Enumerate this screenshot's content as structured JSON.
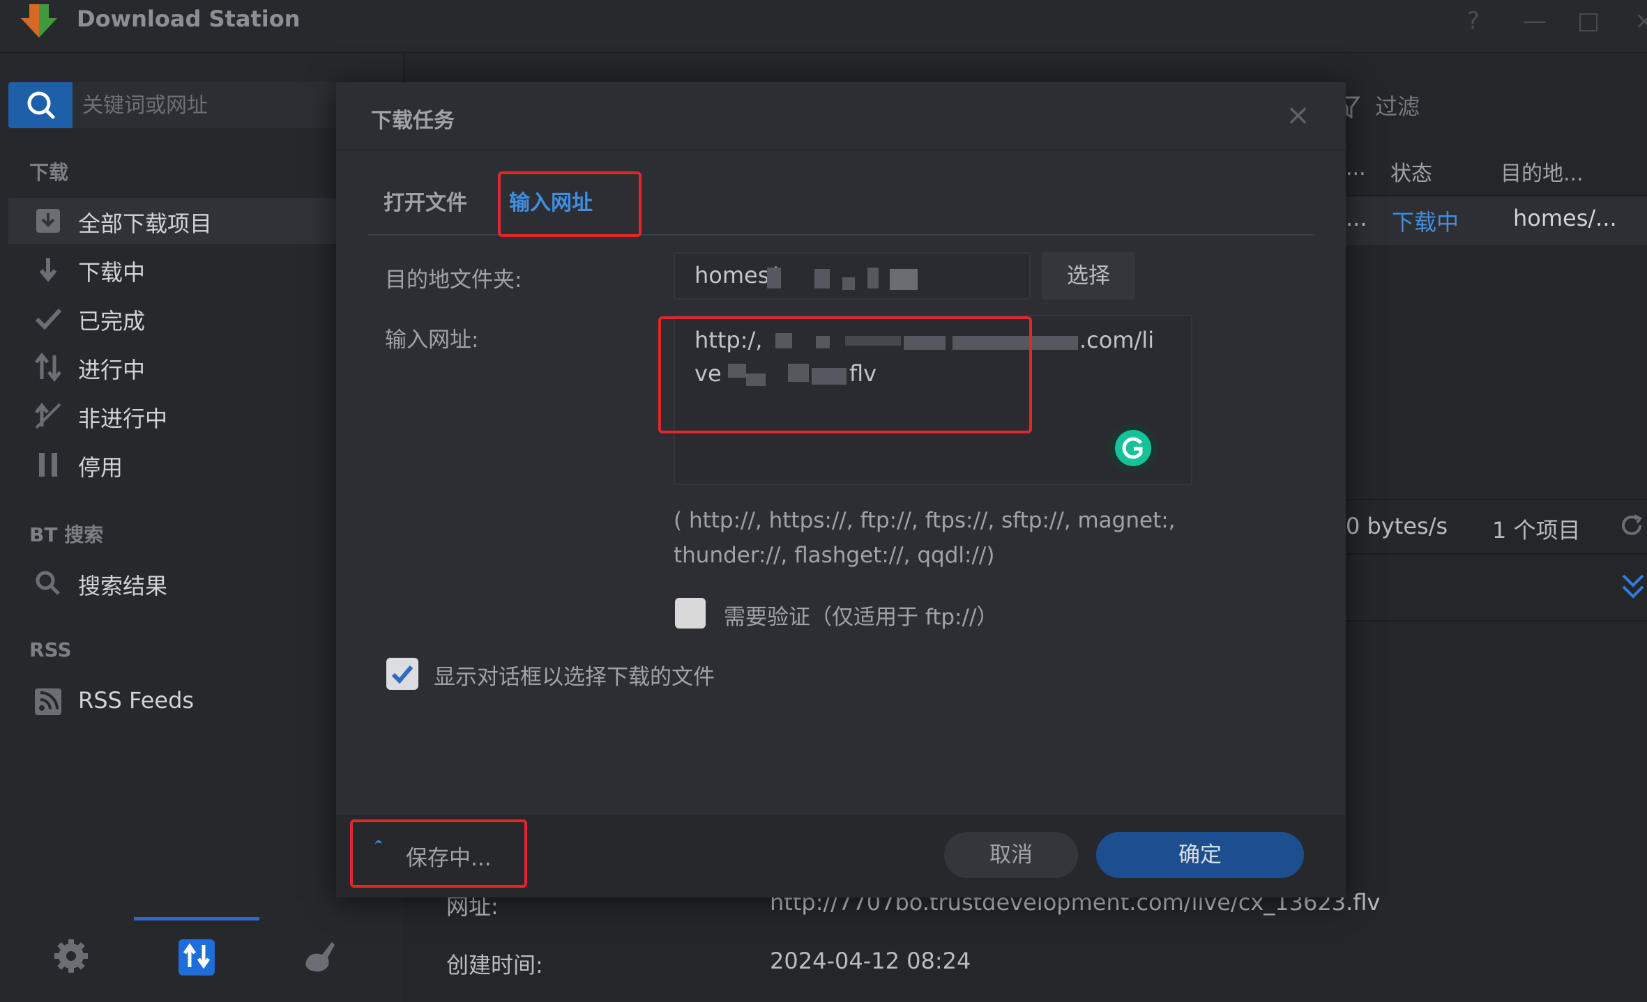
{
  "app": {
    "title": "Download Station"
  },
  "search": {
    "placeholder": "关键词或网址"
  },
  "sidebar": {
    "download_section": "下载",
    "items": [
      {
        "label": "全部下载项目",
        "icon": "download-box-icon"
      },
      {
        "label": "下载中",
        "icon": "arrow-down-icon"
      },
      {
        "label": "已完成",
        "icon": "check-icon"
      },
      {
        "label": "进行中",
        "icon": "updown-arrows-icon"
      },
      {
        "label": "非进行中",
        "icon": "inactive-icon"
      },
      {
        "label": "停用",
        "icon": "pause-icon"
      }
    ],
    "bt_section": "BT 搜索",
    "bt_items": [
      {
        "label": "搜索结果",
        "icon": "search-icon"
      }
    ],
    "rss_section": "RSS",
    "rss_items": [
      {
        "label": "RSS Feeds",
        "icon": "rss-icon"
      }
    ]
  },
  "main": {
    "filter_label": "过滤",
    "columns": [
      "...",
      "状态",
      "目的地..."
    ],
    "rows": [
      {
        "c1": "...",
        "status": "下载中",
        "dest": "homes/..."
      }
    ],
    "status": {
      "speed": "0 bytes/s",
      "count": "1 个项目"
    },
    "details": [
      {
        "label": "网址:",
        "value": "http://7707bo.trustdevelopment.com/live/cx_13623.flv"
      },
      {
        "label": "创建时间:",
        "value": "2024-04-12 08:24"
      }
    ]
  },
  "dialog": {
    "title": "下载任务",
    "tabs": [
      "打开文件",
      "输入网址"
    ],
    "active_tab": "输入网址",
    "dest_label": "目的地文件夹:",
    "dest_value": "homes/",
    "choose_button": "选择",
    "url_label": "输入网址:",
    "url_line1_start": "http:/,",
    "url_line1_end": ".com/li",
    "url_line2_start": "ve",
    "url_line2_end": "flv",
    "protocols_line1": "( http://, https://, ftp://, ftps://, sftp://, magnet:,",
    "protocols_line2": "thunder://, flashget://, qqdl://)",
    "auth_label": "需要验证（仅适用于 ftp://）",
    "show_dialog_label": "显示对话框以选择下载的文件",
    "saving_text": "保存中...",
    "cancel_button": "取消",
    "ok_button": "确定"
  },
  "colors": {
    "accent": "#1d5fa8",
    "annotation": "#e2262c",
    "status_downloading": "#3f8fe0"
  }
}
